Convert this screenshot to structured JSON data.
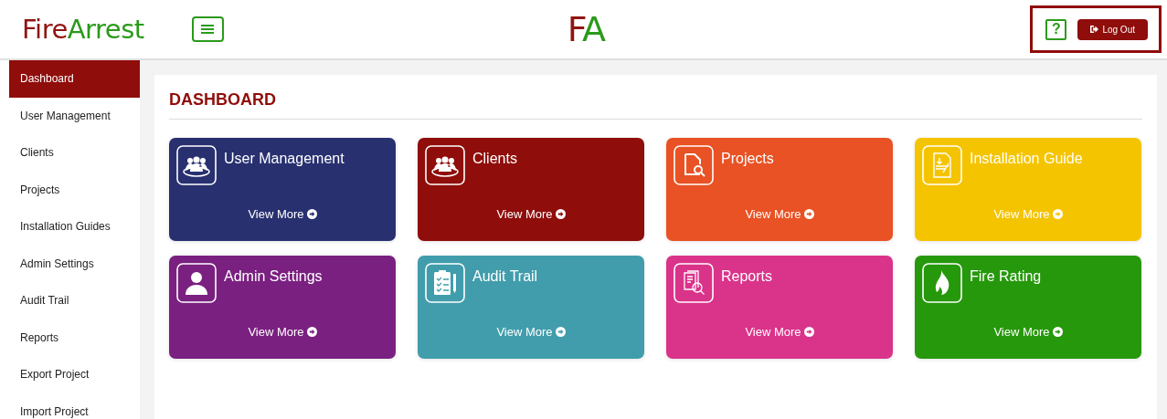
{
  "header": {
    "logo": {
      "part_1": "Fire",
      "part_2": "Arrest"
    },
    "brand_mark": {
      "part_1": "F",
      "part_2": "A"
    },
    "help_button": "?",
    "logout_button": "Log Out"
  },
  "sidebar": {
    "items": [
      {
        "label": "Dashboard",
        "selected": true
      },
      {
        "label": "User Management",
        "selected": false
      },
      {
        "label": "Clients",
        "selected": false
      },
      {
        "label": "Projects",
        "selected": false
      },
      {
        "label": "Installation Guides",
        "selected": false
      },
      {
        "label": "Admin Settings",
        "selected": false
      },
      {
        "label": "Audit Trail",
        "selected": false
      },
      {
        "label": "Reports",
        "selected": false
      },
      {
        "label": "Export Project",
        "selected": false
      },
      {
        "label": "Import Project",
        "selected": false
      }
    ]
  },
  "page": {
    "title": "DASHBOARD",
    "cards": [
      {
        "title": "User Management",
        "link": "View More",
        "color": "#283070",
        "kind": "users"
      },
      {
        "title": "Clients",
        "link": "View More",
        "color": "#8f0d0a",
        "kind": "users"
      },
      {
        "title": "Projects",
        "link": "View More",
        "color": "#e85224",
        "kind": "file-search"
      },
      {
        "title": "Installation Guide",
        "link": "View More",
        "color": "#f5c400",
        "kind": "guide"
      },
      {
        "title": "Admin Settings",
        "link": "View More",
        "color": "#7a2080",
        "kind": "person"
      },
      {
        "title": "Audit Trail",
        "link": "View More",
        "color": "#419dac",
        "kind": "clipboard"
      },
      {
        "title": "Reports",
        "link": "View More",
        "color": "#da338a",
        "kind": "report"
      },
      {
        "title": "Fire Rating",
        "link": "View More",
        "color": "#26980c",
        "kind": "flame"
      }
    ]
  }
}
